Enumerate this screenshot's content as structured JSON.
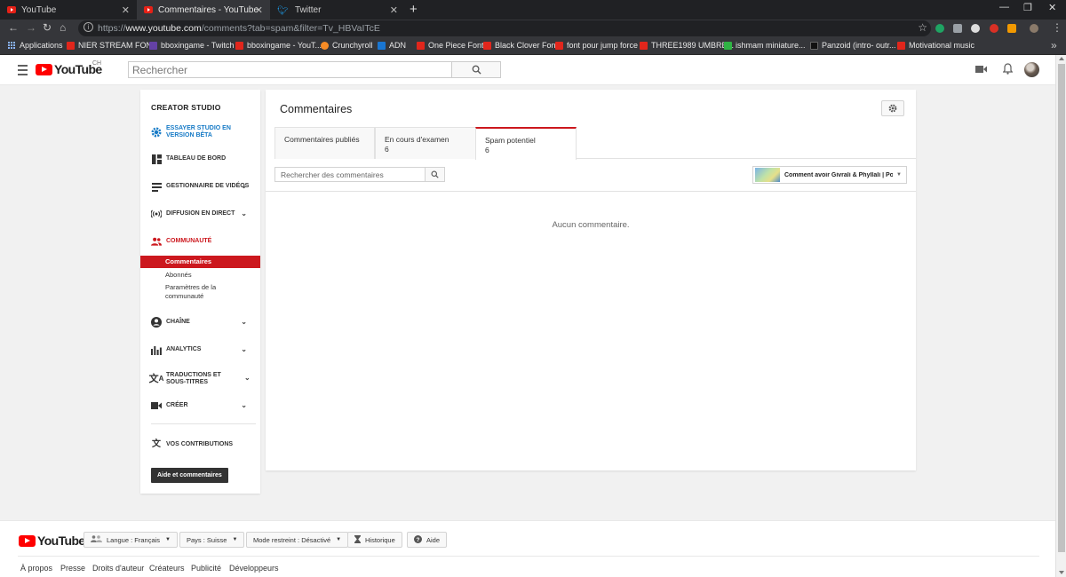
{
  "browser": {
    "tabs": [
      {
        "title": "YouTube",
        "favicon": "youtube-icon"
      },
      {
        "title": "Commentaires - YouTube",
        "favicon": "youtube-icon"
      },
      {
        "title": "Twitter",
        "favicon": "twitter-icon"
      }
    ],
    "url_prefix": "https://",
    "url_host": "www.youtube.com",
    "url_path": "/comments?tab=spam&filter=Tv_HBVaITcE",
    "bookmarks": [
      {
        "label": "Applications",
        "icon": "apps-grid-icon"
      },
      {
        "label": "NIER STREAM FONT",
        "icon": "font-icon"
      },
      {
        "label": "bboxingame - Twitch",
        "icon": "twitch-icon"
      },
      {
        "label": "bboxingame - YouT...",
        "icon": "youtube-icon"
      },
      {
        "label": "Crunchyroll",
        "icon": "crunchyroll-icon"
      },
      {
        "label": "ADN",
        "icon": "adn-icon"
      },
      {
        "label": "One Piece Font",
        "icon": "font-icon"
      },
      {
        "label": "Black Clover Font",
        "icon": "font-icon"
      },
      {
        "label": "font pour jump force",
        "icon": "font-icon"
      },
      {
        "label": "THREE1989 UMBRE...",
        "icon": "youtube-icon"
      },
      {
        "label": "ishmam miniature...",
        "icon": "leaf-icon"
      },
      {
        "label": "Panzoid (intro- outr...",
        "icon": "panzoid-icon"
      },
      {
        "label": "Motivational music",
        "icon": "youtube-icon"
      }
    ]
  },
  "header": {
    "logo_text": "YouTube",
    "country": "CH",
    "search_placeholder": "Rechercher"
  },
  "sidebar": {
    "title": "CREATOR STUDIO",
    "beta": "ESSAYER STUDIO EN VERSION BÊTA",
    "items": [
      {
        "label": "TABLEAU DE BORD"
      },
      {
        "label": "GESTIONNAIRE DE VIDÉOS"
      },
      {
        "label": "DIFFUSION EN DIRECT"
      },
      {
        "label": "COMMUNAUTÉ"
      }
    ],
    "sub_items": [
      {
        "label": "Commentaires"
      },
      {
        "label": "Abonnés"
      },
      {
        "label": "Paramètres de la communauté"
      }
    ],
    "lower_items": [
      {
        "label": "CHAÎNE"
      },
      {
        "label": "ANALYTICS"
      },
      {
        "label": "TRADUCTIONS ET SOUS-TITRES"
      },
      {
        "label": "CRÉER"
      }
    ],
    "contrib": "VOS CONTRIBUTIONS",
    "help_button": "Aide et commentaires"
  },
  "main": {
    "title": "Commentaires",
    "tabs": [
      {
        "label": "Commentaires publiés",
        "count": ""
      },
      {
        "label": "En cours d'examen",
        "count": "6"
      },
      {
        "label": "Spam potentiel",
        "count": "6"
      }
    ],
    "search_placeholder": "Rechercher des commentaires",
    "video_selector": "Comment avoir Givrali & Phyllali | Poke...",
    "empty_message": "Aucun commentaire."
  },
  "footer": {
    "logo_text": "YouTube",
    "language": "Langue : Français",
    "country": "Pays : Suisse",
    "restricted": "Mode restreint : Désactivé",
    "history": "Historique",
    "help": "Aide",
    "links": [
      "À propos",
      "Presse",
      "Droits d'auteur",
      "Créateurs",
      "Publicité",
      "Développeurs"
    ]
  },
  "colors": {
    "accent_red": "#cc181e",
    "link_blue": "#167ac6",
    "youtube_red": "#ff0000"
  }
}
